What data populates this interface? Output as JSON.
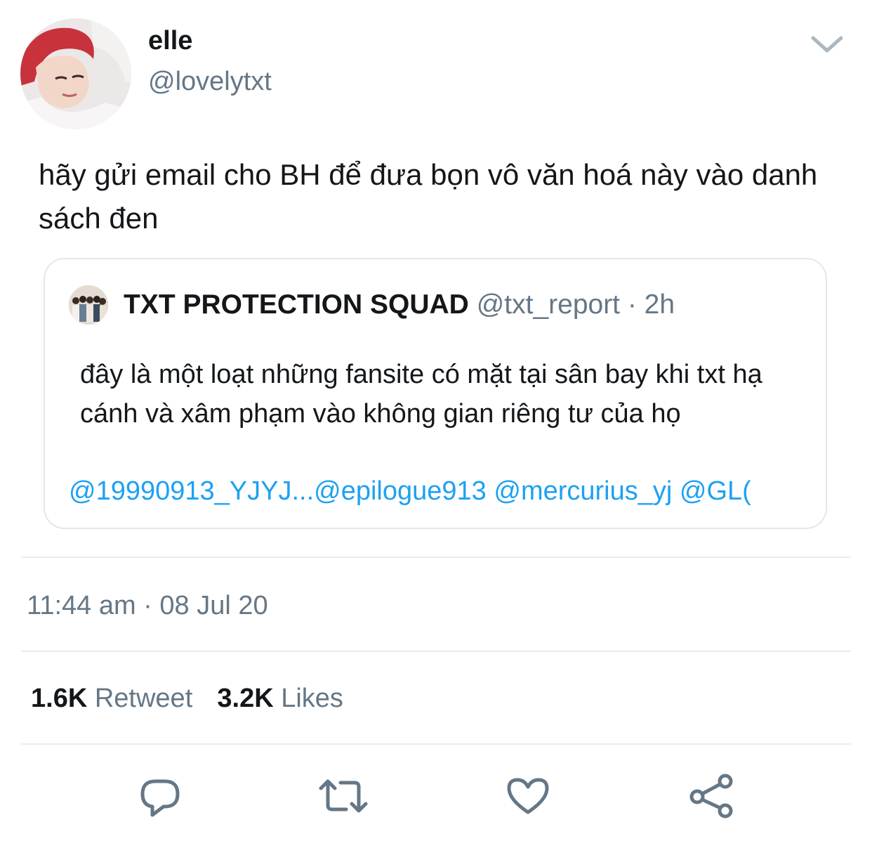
{
  "tweet": {
    "author": {
      "display_name": "elle",
      "handle": "@lovelytxt"
    },
    "text": "hãy gửi email cho BH để đưa bọn vô văn hoá này vào danh sách đen",
    "timestamp": "11:44 am · 08 Jul 20",
    "stats": {
      "retweets_count": "1.6K",
      "retweets_label": "Retweet",
      "likes_count": "3.2K",
      "likes_label": "Likes"
    }
  },
  "quoted_tweet": {
    "display_name": "TXT PROTECTION SQUAD",
    "handle_time": "@txt_report · 2h",
    "text": "đây là một loạt những fansite có mặt tại sân bay khi txt hạ cánh và xâm phạm vào không gian riêng tư của họ",
    "mentions": "@19990913_YJYJ...@epilogue913 @mercurius_yj @GL("
  },
  "icons": {
    "menu": "chevron-down-icon",
    "reply": "reply-icon",
    "retweet": "retweet-icon",
    "like": "heart-icon",
    "share": "share-icon"
  },
  "colors": {
    "text_primary": "#14171a",
    "text_secondary": "#657786",
    "link": "#1da1f2",
    "border": "#e1e8ed",
    "icon": "#657786"
  }
}
